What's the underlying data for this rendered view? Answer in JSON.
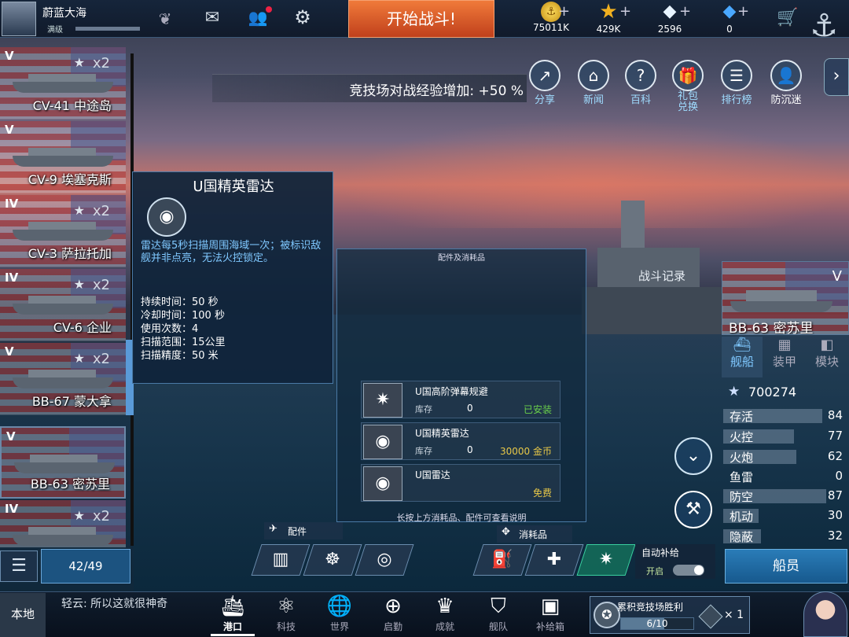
{
  "player": {
    "name": "蔚蓝大海",
    "level": "满级"
  },
  "top_buttons": {
    "battle": "开始战斗!"
  },
  "currencies": [
    {
      "icon": "gold-coin-icon",
      "value": "75011K"
    },
    {
      "icon": "gold-star-icon",
      "value": "429K"
    },
    {
      "icon": "diamond-icon",
      "value": "2596"
    },
    {
      "icon": "blue-crystal-icon",
      "value": "0"
    }
  ],
  "banner": {
    "text": "竞技场对战经验增加:  +50 %"
  },
  "menu_icons": [
    {
      "icon": "share-icon",
      "label": "分享"
    },
    {
      "icon": "news-icon",
      "label": "新闻"
    },
    {
      "icon": "encyclopedia-icon",
      "label": "百科"
    },
    {
      "icon": "gift-exchange-icon",
      "label": "礼包\n兑换"
    },
    {
      "icon": "ranking-icon",
      "label": "排行榜"
    },
    {
      "icon": "anti-addiction-icon",
      "label": "防沉迷"
    }
  ],
  "ships": [
    {
      "tier": "V",
      "name": "CV-41 中途岛",
      "mult": "x2"
    },
    {
      "tier": "V",
      "name": "CV-9 埃塞克斯",
      "mult": ""
    },
    {
      "tier": "IV",
      "name": "CV-3 萨拉托加",
      "mult": "x2"
    },
    {
      "tier": "IV",
      "name": "CV-6 企业",
      "mult": "x2"
    },
    {
      "tier": "V",
      "name": "BB-67 蒙大拿",
      "mult": "x2"
    },
    {
      "tier": "V",
      "name": "BB-63 密苏里",
      "mult": ""
    },
    {
      "tier": "IV",
      "name": "",
      "mult": "x2"
    }
  ],
  "ship_count": "42/49",
  "tooltip": {
    "title": "U国精英雷达",
    "desc": "雷达每5秒扫描周围海域一次；被标识敌舰并非点亮，无法火控锁定。",
    "stats": [
      "持续时间：50 秒",
      "冷却时间：100 秒",
      "使用次数：4",
      "扫描范围：15公里",
      "扫描精度：50 米"
    ]
  },
  "equip_panel": {
    "title": "配件及消耗品",
    "items": [
      {
        "name": "U国高阶弹幕规避",
        "stock_label": "库存",
        "stock": "0",
        "status": "已安装"
      },
      {
        "name": "U国精英雷达",
        "stock_label": "库存",
        "stock": "0",
        "status": "30000 金币"
      },
      {
        "name": "U国雷达",
        "stock_label": "",
        "stock": "",
        "status": "免费"
      }
    ],
    "hint": "长按上方消耗品、配件可查看说明"
  },
  "battle_record": "战斗记录",
  "selected_ship": {
    "tier": "V",
    "name": "BB-63 密苏里",
    "tabs": [
      "舰船",
      "装甲",
      "模块"
    ],
    "rating": "700274",
    "stats": [
      {
        "label": "存活",
        "value": "84",
        "fill": 0.84
      },
      {
        "label": "火控",
        "value": "77",
        "fill": 0.6
      },
      {
        "label": "火炮",
        "value": "62",
        "fill": 0.62
      },
      {
        "label": "鱼雷",
        "value": "0",
        "fill": 0
      },
      {
        "label": "防空",
        "value": "87",
        "fill": 0.87
      },
      {
        "label": "机动",
        "value": "30",
        "fill": 0.3
      },
      {
        "label": "隐蔽",
        "value": "32",
        "fill": 0.32
      }
    ],
    "crew_button": "船员"
  },
  "loadout": {
    "accessories": "配件",
    "consumables": "消耗品",
    "auto_supply": "自动补给",
    "toggle": "开启"
  },
  "chat": {
    "channel": "本地",
    "message": "轻云: 所以这就很神奇"
  },
  "bottom_nav": [
    {
      "icon": "port-icon",
      "label": "港口"
    },
    {
      "icon": "tech-icon",
      "label": "科技"
    },
    {
      "icon": "world-icon",
      "label": "世界"
    },
    {
      "icon": "launch-icon",
      "label": "启勤"
    },
    {
      "icon": "achievement-icon",
      "label": "成就"
    },
    {
      "icon": "fleet-icon",
      "label": "舰队"
    },
    {
      "icon": "supply-box-icon",
      "label": "补给箱"
    }
  ],
  "quest": {
    "title": "累积竞技场胜利",
    "progress": "6/10",
    "progress_value": 0.6,
    "reward_count": "× 1"
  }
}
